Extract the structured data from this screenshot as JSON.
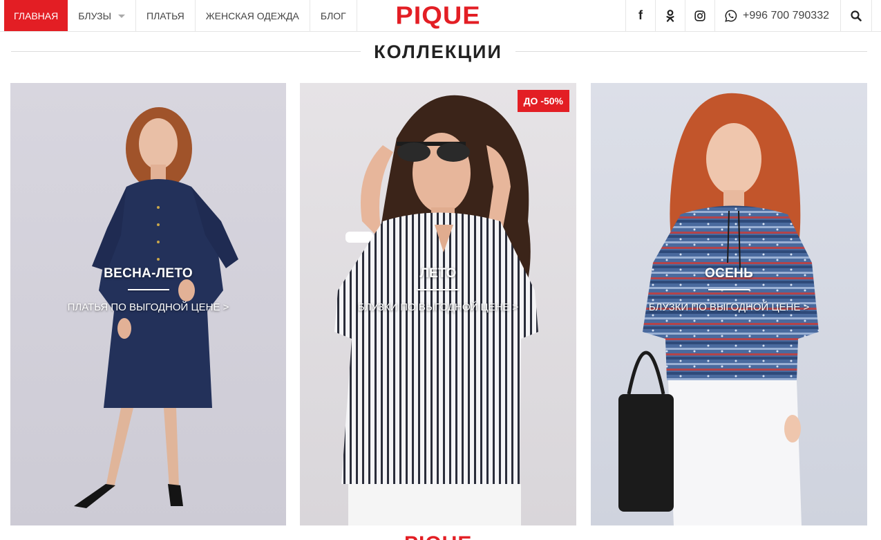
{
  "nav": {
    "items": [
      {
        "label": "ГЛАВНАЯ"
      },
      {
        "label": "БЛУЗЫ"
      },
      {
        "label": "ПЛАТЬЯ"
      },
      {
        "label": "ЖЕНСКАЯ ОДЕЖДА"
      },
      {
        "label": "БЛОГ"
      }
    ],
    "logo": "PIQUE",
    "phone": "+996 700 790332",
    "social": [
      "facebook-icon",
      "odnoklassniki-icon",
      "instagram-icon"
    ],
    "whatsapp_icon": "whatsapp-icon",
    "search_icon": "search-icon"
  },
  "collections": {
    "heading": "КОЛЛЕКЦИИ",
    "cards": [
      {
        "title": "ВЕСНА-ЛЕТО",
        "link": "ПЛАТЬЯ ПО ВЫГОДНОЙ ЦЕНЕ  >"
      },
      {
        "title": "ЛЕТО",
        "link": "БЛУЗКИ ПО ВЫГОДНОЙ ЦЕНЕ  >",
        "badge": "ДО -50%"
      },
      {
        "title": "ОСЕНЬ",
        "link": "БЛУЗКИ ПО ВЫГОДНОЙ ЦЕНЕ  >"
      }
    ]
  },
  "footer": {
    "logo_peek": "PIQUE"
  },
  "colors": {
    "accent": "#e31e24"
  }
}
